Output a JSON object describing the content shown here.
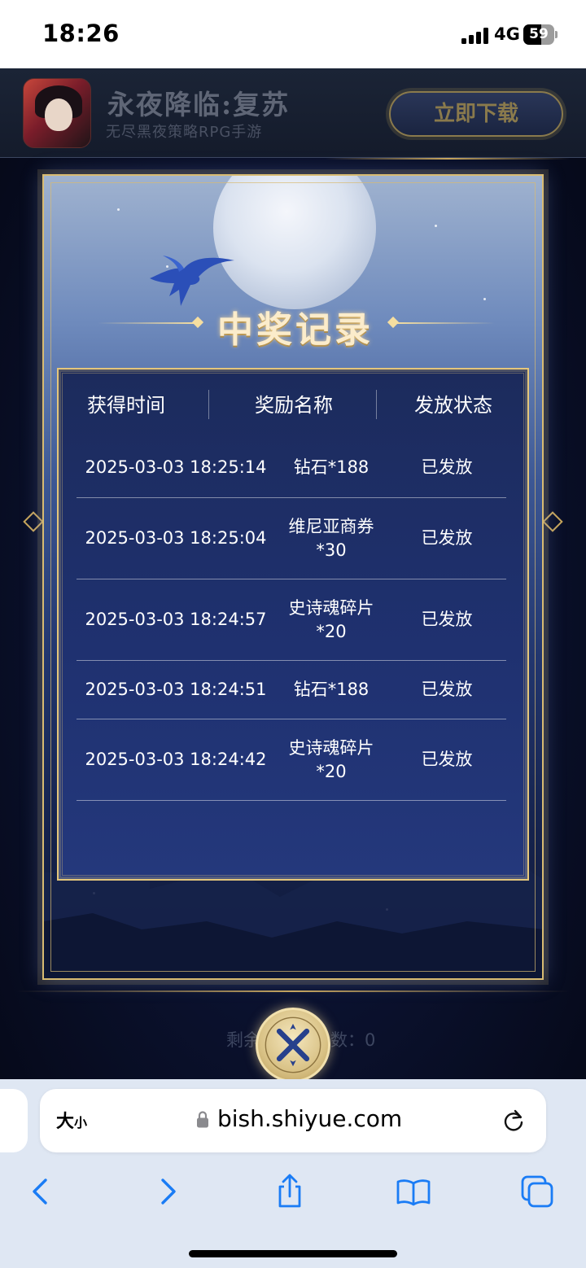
{
  "status_bar": {
    "time": "18:26",
    "network": "4G",
    "battery_level": "59",
    "battery_fraction": 0.59
  },
  "ad": {
    "title": "永夜降临:复苏",
    "subtitle": "无尽黑夜策略RPG手游",
    "download_label": "立即下载"
  },
  "modal": {
    "title": "中奖记录",
    "columns": [
      "获得时间",
      "奖励名称",
      "发放状态"
    ],
    "rows": [
      {
        "time": "2025-03-03 18:25:14",
        "name_lines": [
          "钻石*188"
        ],
        "status": "已发放"
      },
      {
        "time": "2025-03-03 18:25:04",
        "name_lines": [
          "维尼亚商券",
          "*30"
        ],
        "status": "已发放"
      },
      {
        "time": "2025-03-03 18:24:57",
        "name_lines": [
          "史诗魂碎片",
          "*20"
        ],
        "status": "已发放"
      },
      {
        "time": "2025-03-03 18:24:51",
        "name_lines": [
          "钻石*188"
        ],
        "status": "已发放"
      },
      {
        "time": "2025-03-03 18:24:42",
        "name_lines": [
          "史诗魂碎片",
          "*20"
        ],
        "status": "已发放"
      }
    ]
  },
  "remaining": {
    "prefix": "剩余",
    "suffix": "数：",
    "value": "0"
  },
  "browser": {
    "text_size_label_big": "大",
    "text_size_label_small": "小",
    "url": "bish.shiyue.com"
  },
  "colors": {
    "gold": "#e4c67b",
    "panel_blue": "#1f3170",
    "safari_bg": "#dfe7f3",
    "ios_blue": "#1a7cf5"
  }
}
